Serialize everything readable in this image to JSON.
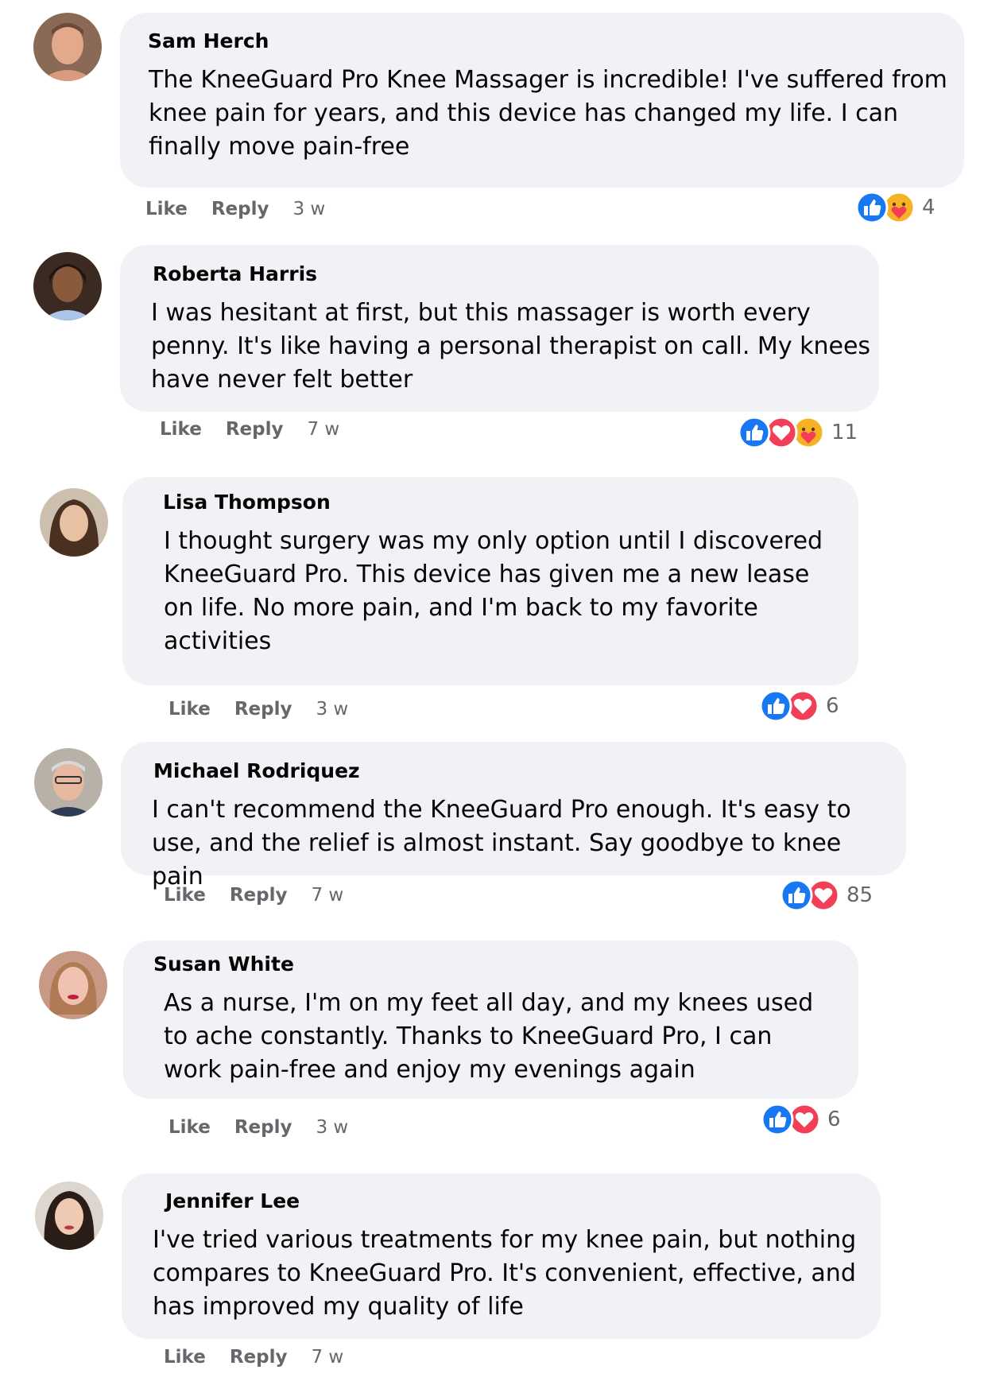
{
  "colors": {
    "bubble": "#f0f2f5",
    "like_blue": "#1877f2",
    "love_red": "#f33e58",
    "care_yellow": "#f7b125",
    "meta_text": "#65676b"
  },
  "comments": [
    {
      "author": "Sam Herch",
      "text": "The KneeGuard Pro Knee Massager is incredible! I've suffered from knee pain for years, and this device has changed my life. I can finally move pain-free",
      "like_label": "Like",
      "reply_label": "Reply",
      "time": "3 w",
      "reactions": [
        "like-icon",
        "care-icon"
      ],
      "reaction_count": "4"
    },
    {
      "author": "Roberta Harris",
      "text": "I was hesitant at first, but this massager is worth every penny. It's like having a personal therapist on call. My knees have never felt better",
      "like_label": "Like",
      "reply_label": "Reply",
      "time": "7 w",
      "reactions": [
        "like-icon",
        "love-icon",
        "care-icon"
      ],
      "reaction_count": "11"
    },
    {
      "author": "Lisa Thompson",
      "text": "I thought surgery was my only option until I discovered KneeGuard Pro. This device has given me a new lease on life. No more pain, and I'm back to my favorite activities",
      "like_label": "Like",
      "reply_label": "Reply",
      "time": "3 w",
      "reactions": [
        "like-icon",
        "love-icon"
      ],
      "reaction_count": "6"
    },
    {
      "author": "Michael Rodriquez",
      "text": "I can't recommend the KneeGuard Pro enough. It's easy to use, and the relief is almost instant. Say goodbye to knee pain",
      "like_label": "Like",
      "reply_label": "Reply",
      "time": "7 w",
      "reactions": [
        "like-icon",
        "love-icon"
      ],
      "reaction_count": "85"
    },
    {
      "author": "Susan White",
      "text": "As a nurse, I'm on my feet all day, and my knees used to ache constantly. Thanks to KneeGuard Pro, I can work pain-free and enjoy my evenings again",
      "like_label": "Like",
      "reply_label": "Reply",
      "time": "3 w",
      "reactions": [
        "like-icon",
        "love-icon"
      ],
      "reaction_count": "6"
    },
    {
      "author": "Jennifer Lee",
      "text": "I've tried various treatments for my knee pain, but nothing compares to KneeGuard Pro. It's convenient, effective, and has improved my quality of life",
      "like_label": "Like",
      "reply_label": "Reply",
      "time": "7 w",
      "reactions": [],
      "reaction_count": ""
    }
  ]
}
